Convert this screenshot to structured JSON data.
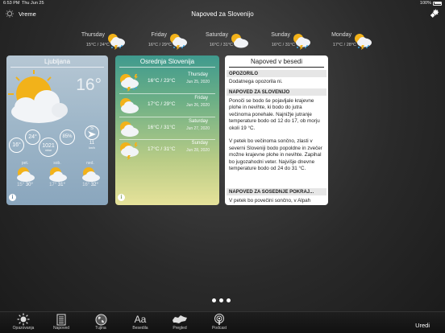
{
  "status_bar": {
    "time": "6:53 PM",
    "date": "Thu Jun 25",
    "battery": "100%"
  },
  "nav": {
    "back_label": "Vreme",
    "title": "Napoved za Slovenijo"
  },
  "forecast_strip": [
    {
      "day": "Thursday",
      "temps": "15°C / 24°C",
      "icon": "sun-cloud-storm-icon"
    },
    {
      "day": "Friday",
      "temps": "16°C / 29°C",
      "icon": "sun-cloud-storm-icon"
    },
    {
      "day": "Saturday",
      "temps": "16°C / 31°C",
      "icon": "sun-cloud-icon"
    },
    {
      "day": "Sunday",
      "temps": "16°C / 31°C",
      "icon": "sun-cloud-storm-icon"
    },
    {
      "day": "Monday",
      "temps": "17°C / 28°C",
      "icon": "sun-cloud-storm-icon"
    }
  ],
  "city_card": {
    "title": "Ljubljana",
    "current_temp": "16°",
    "gauges": {
      "temp_min": "16°",
      "temp_max": "24°",
      "pressure": "1021",
      "pressure_unit": "mbar",
      "humidity": "85%",
      "wind_dir": "S",
      "wind_speed": "11",
      "wind_unit": "km/h"
    },
    "days": [
      {
        "name": "pet.",
        "lo": "15°",
        "hi": "30°"
      },
      {
        "name": "sob.",
        "lo": "17°",
        "hi": "31°"
      },
      {
        "name": "ned.",
        "lo": "16°",
        "hi": "32°"
      }
    ]
  },
  "region_card": {
    "title": "Osrednja Slovenija",
    "rows": [
      {
        "temp": "16°C / 23°C",
        "day": "Thursday",
        "date": "Jun 25, 2020",
        "icon": "sun-cloud-storm-icon"
      },
      {
        "temp": "17°C / 29°C",
        "day": "Friday",
        "date": "Jun 26, 2020",
        "icon": "sun-cloud-icon"
      },
      {
        "temp": "16°C / 31°C",
        "day": "Saturday",
        "date": "Jun 27, 2020",
        "icon": "sun-cloud-icon"
      },
      {
        "temp": "17°C / 31°C",
        "day": "Sunday",
        "date": "Jun 28, 2020",
        "icon": "sun-cloud-storm-icon"
      }
    ]
  },
  "text_card": {
    "title": "Napoved v besedi",
    "sections": [
      {
        "head": "OPOZORILO",
        "body": "Dodatnega opozorila ni."
      },
      {
        "head": "NAPOVED ZA SLOVENIJO",
        "body": "Ponoči se bodo še pojavljale krajevne plohe in nevihte, ki bodo do jutra večinoma ponehale. Najnižje jutranje temperature bodo od 12 do 17, ob morju okoli 19 °C.\n\nV petek bo večinoma sončno, zlasti v severni Sloveniji bodo popoldne in zvečer možne krajevne plohe in nevihte. Zapihal bo jugozahodni veter. Najvišje dnevne temperature bodo od 24 do 31 °C."
      },
      {
        "head": "NAPOVED ZA SOSEDNJE POKRAJ...",
        "body": "V petek bo povečini sončno, v Alpah"
      }
    ]
  },
  "tabs": [
    {
      "label": "Opazovanja",
      "icon": "sun-icon"
    },
    {
      "label": "Napoved",
      "icon": "document-icon"
    },
    {
      "label": "Tujina",
      "icon": "globe-icon"
    },
    {
      "label": "Besedila",
      "icon": "text-icon"
    },
    {
      "label": "Pregled",
      "icon": "map-icon"
    },
    {
      "label": "Podcast",
      "icon": "podcast-icon"
    }
  ],
  "tab_text_aa": "Aa",
  "edit_label": "Uredi"
}
